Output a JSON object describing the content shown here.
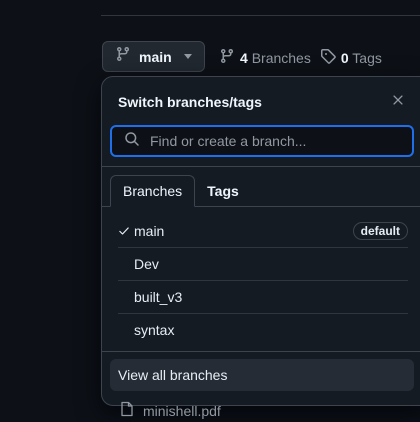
{
  "branch_button": {
    "label": "main"
  },
  "stats": {
    "branches_count": "4",
    "branches_label": "Branches",
    "tags_count": "0",
    "tags_label": "Tags"
  },
  "panel": {
    "title": "Switch branches/tags",
    "search_placeholder": "Find or create a branch...",
    "tabs": [
      {
        "label": "Branches"
      },
      {
        "label": "Tags"
      }
    ],
    "branches": [
      {
        "name": "main",
        "selected": true,
        "badge": "default"
      },
      {
        "name": "Dev"
      },
      {
        "name": "built_v3"
      },
      {
        "name": "syntax"
      }
    ],
    "view_all_label": "View all branches"
  },
  "file": {
    "name": "minishell.pdf"
  },
  "icons": {
    "branch": "git-branch-icon",
    "tag": "tag-icon",
    "search": "search-icon",
    "close": "close-icon",
    "check": "check-icon",
    "file": "file-icon"
  },
  "colors": {
    "background": "#0d1117",
    "panel": "#151b23",
    "accent_focus": "#1f6feb",
    "border": "#3d444d"
  }
}
